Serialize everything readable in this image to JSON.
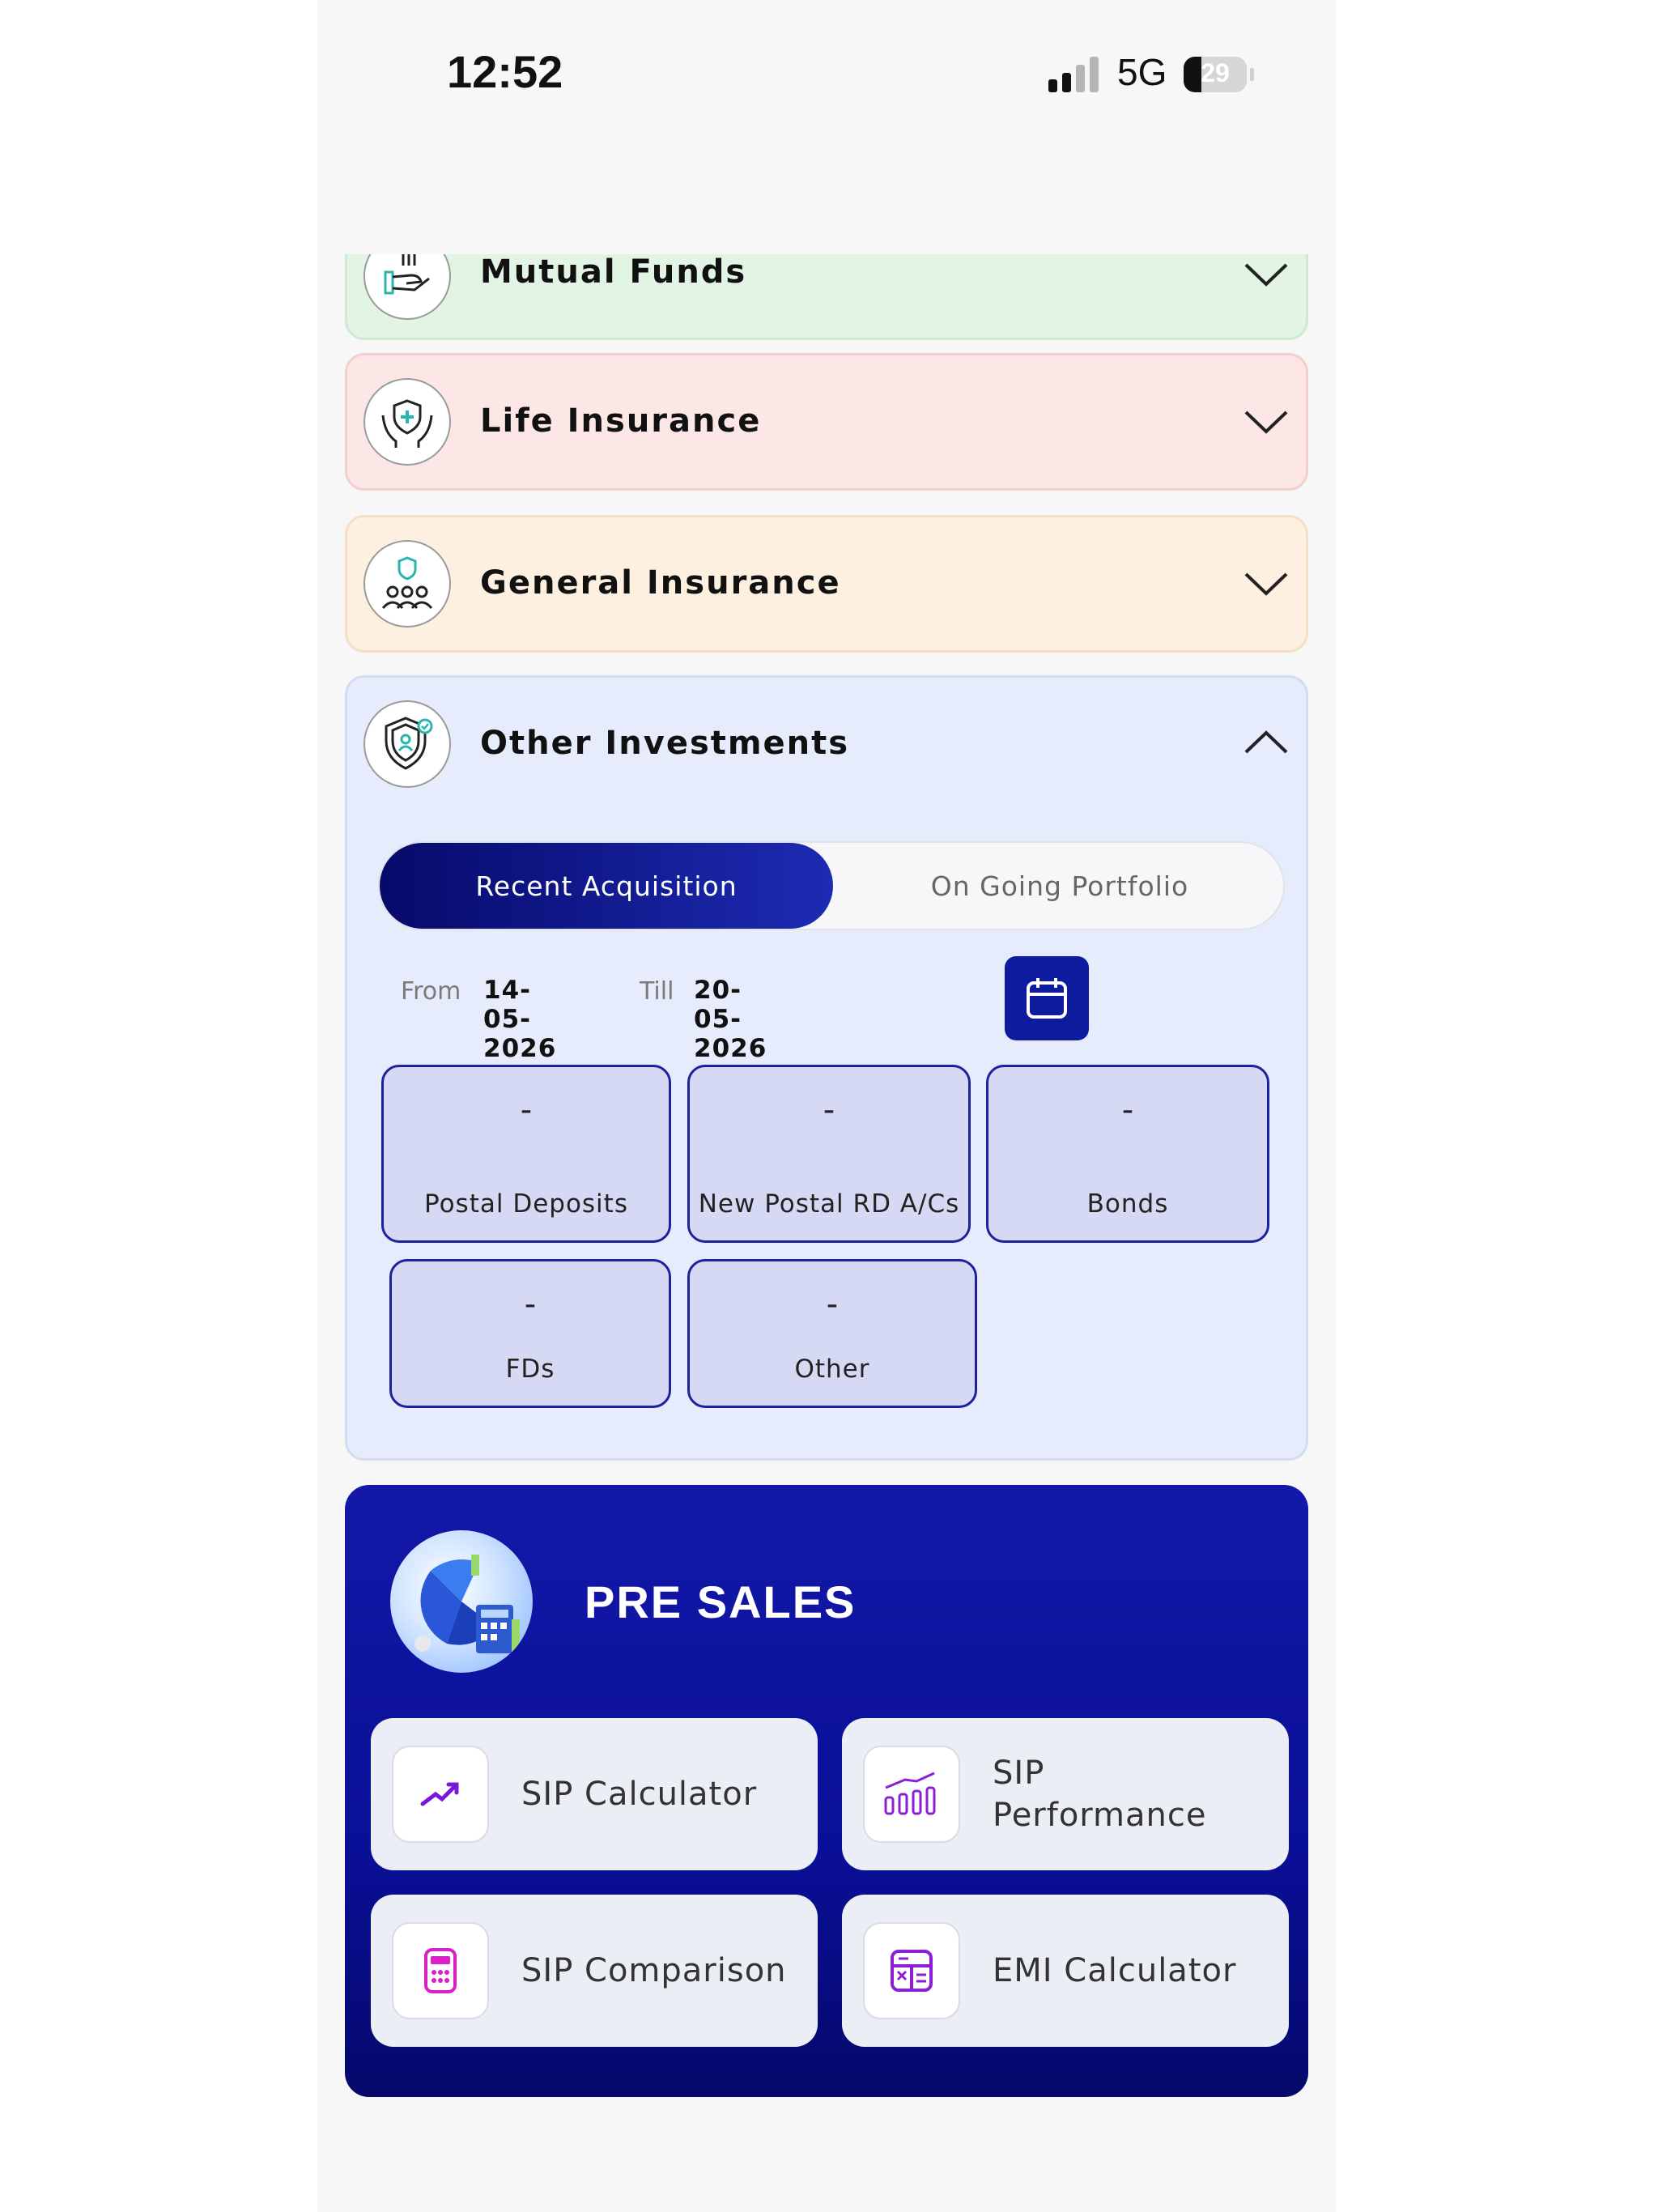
{
  "status_bar": {
    "time": "12:52",
    "network": "5G",
    "battery": "29"
  },
  "accordions": [
    {
      "title": "Mutual Funds",
      "expanded": false,
      "color": "#e2f4e4",
      "icon": "hand-coins-icon"
    },
    {
      "title": "Life Insurance",
      "expanded": false,
      "color": "#fde7e6",
      "icon": "hands-shield-icon"
    },
    {
      "title": "General Insurance",
      "expanded": false,
      "color": "#fdf0e1",
      "icon": "family-shield-icon"
    },
    {
      "title": "Other Investments",
      "expanded": true,
      "color": "#e6ecfb",
      "icon": "person-shield-icon"
    }
  ],
  "other_investments": {
    "tabs": {
      "active": "Recent Acquisition",
      "inactive": "On Going Portfolio"
    },
    "date_filter": {
      "from_label": "From",
      "from_value": "14-05-2026",
      "till_label": "Till",
      "till_value": "20-05-2026"
    },
    "tiles": [
      {
        "value": "-",
        "label": "Postal Deposits"
      },
      {
        "value": "-",
        "label": "New Postal RD A/Cs"
      },
      {
        "value": "-",
        "label": "Bonds"
      },
      {
        "value": "-",
        "label": "FDs"
      },
      {
        "value": "-",
        "label": "Other"
      }
    ]
  },
  "pre_sales": {
    "title": "PRE SALES",
    "items": [
      {
        "label": "SIP Calculator",
        "icon": "trending-up-icon"
      },
      {
        "label": "SIP Performance",
        "icon": "bar-chart-icon"
      },
      {
        "label": "SIP Comparison",
        "icon": "calculator-icon"
      },
      {
        "label": "EMI Calculator",
        "icon": "emi-calculator-icon"
      }
    ]
  },
  "colors": {
    "accent": "#0f1b9e",
    "tile_bg": "#d6d9f4",
    "presales_bg": "#0a0f97"
  }
}
